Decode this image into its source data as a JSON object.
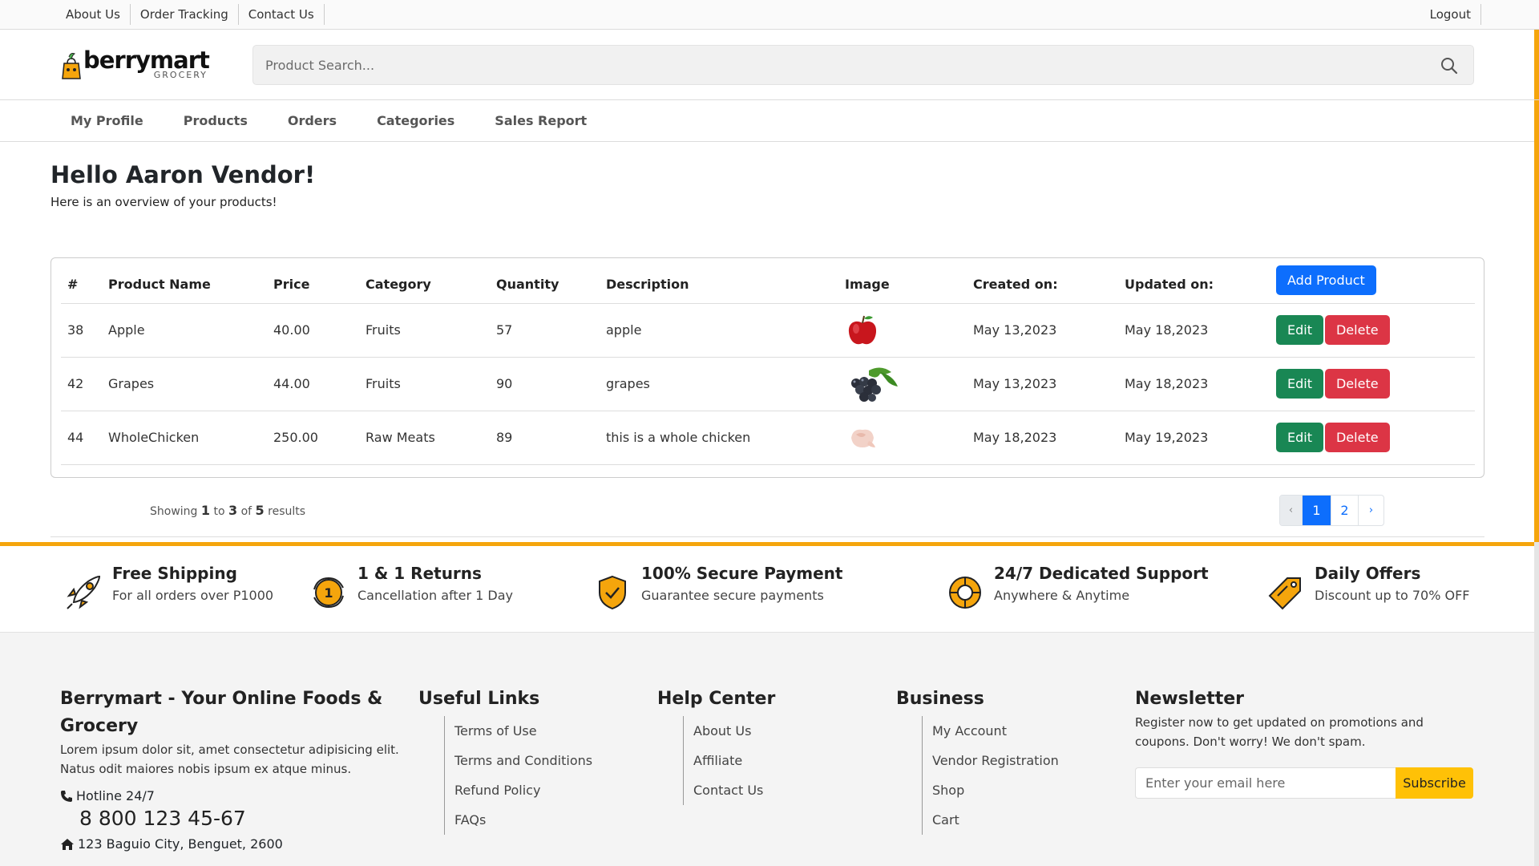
{
  "topbar": {
    "links": [
      "About Us",
      "Order Tracking",
      "Contact Us"
    ],
    "logout": "Logout"
  },
  "logo": {
    "word": "berrymart",
    "sub": "GROCERY"
  },
  "search": {
    "placeholder": "Product Search..."
  },
  "nav": [
    "My Profile",
    "Products",
    "Orders",
    "Categories",
    "Sales Report"
  ],
  "main": {
    "greeting": "Hello Aaron Vendor!",
    "subtitle": "Here is an overview of your products!"
  },
  "table": {
    "headers": [
      "#",
      "Product Name",
      "Price",
      "Category",
      "Quantity",
      "Description",
      "Image",
      "Created on:",
      "Updated on:"
    ],
    "add_button": "Add Product",
    "edit_label": "Edit",
    "delete_label": "Delete",
    "rows": [
      {
        "id": "38",
        "name": "Apple",
        "price": "40.00",
        "category": "Fruits",
        "quantity": "57",
        "description": "apple",
        "image": "apple-image",
        "created": "May 13,2023",
        "updated": "May 18,2023"
      },
      {
        "id": "42",
        "name": "Grapes",
        "price": "44.00",
        "category": "Fruits",
        "quantity": "90",
        "description": "grapes",
        "image": "grapes-image",
        "created": "May 13,2023",
        "updated": "May 18,2023"
      },
      {
        "id": "44",
        "name": "WholeChicken",
        "price": "250.00",
        "category": "Raw Meats",
        "quantity": "89",
        "description": "this is a whole chicken",
        "image": "chicken-image",
        "created": "May 18,2023",
        "updated": "May 19,2023"
      }
    ]
  },
  "pagination": {
    "showing_prefix": "Showing",
    "from": "1",
    "to_word": "to",
    "to": "3",
    "of_word": "of",
    "total": "5",
    "suffix": "results",
    "prev": "‹",
    "pages": [
      "1",
      "2"
    ],
    "next": "›",
    "active_page": "1"
  },
  "features": [
    {
      "icon": "rocket-icon",
      "title": "Free Shipping",
      "desc": "For all orders over P1000"
    },
    {
      "icon": "returns-icon",
      "title": "1 & 1 Returns",
      "desc": "Cancellation after 1 Day"
    },
    {
      "icon": "shield-check-icon",
      "title": "100% Secure Payment",
      "desc": "Guarantee secure payments"
    },
    {
      "icon": "lifebuoy-icon",
      "title": "24/7 Dedicated Support",
      "desc": "Anywhere & Anytime"
    },
    {
      "icon": "tag-icon",
      "title": "Daily Offers",
      "desc": "Discount up to 70% OFF"
    }
  ],
  "footer": {
    "about_title": "Berrymart - Your Online Foods & Grocery",
    "about_text": "Lorem ipsum dolor sit, amet consectetur adipisicing elit. Natus odit maiores nobis ipsum ex atque minus.",
    "hotline_label": "Hotline 24/7",
    "hotline_number": "8 800 123 45-67",
    "address": "123 Baguio City, Benguet, 2600",
    "useful_title": "Useful Links",
    "useful_links": [
      "Terms of Use",
      "Terms and Conditions",
      "Refund Policy",
      "FAQs"
    ],
    "help_title": "Help Center",
    "help_links": [
      "About Us",
      "Affiliate",
      "Contact Us"
    ],
    "business_title": "Business",
    "business_links": [
      "My Account",
      "Vendor Registration",
      "Shop",
      "Cart"
    ],
    "newsletter_title": "Newsletter",
    "newsletter_text": "Register now to get updated on promotions and coupons. Don't worry! We don't spam.",
    "email_placeholder": "Enter your email here",
    "subscribe": "Subscribe"
  },
  "colors": {
    "accent": "#f5a50c",
    "primary": "#0d6efd",
    "success": "#198754",
    "danger": "#dc3545",
    "warning": "#ffc107"
  }
}
